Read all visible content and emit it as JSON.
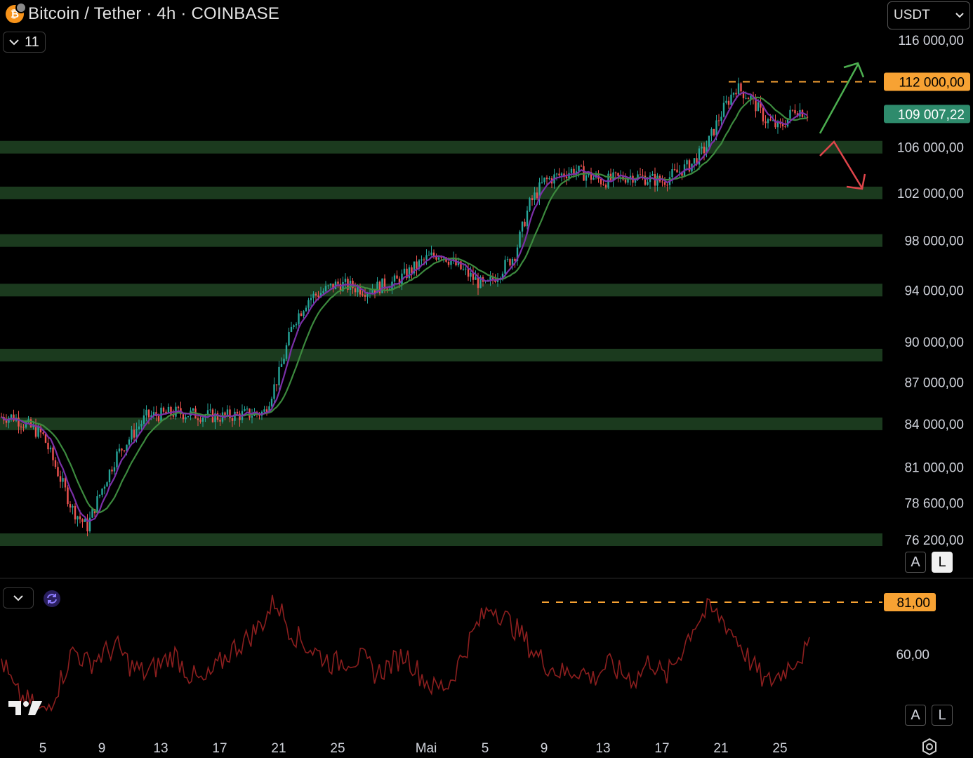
{
  "header": {
    "title": "Bitcoin / Tether · 4h · COINBASE",
    "indicator_count": "11",
    "currency": "USDT"
  },
  "colors": {
    "background": "#000000",
    "up": "#26a69a",
    "down": "#ef5350",
    "zone": "#1b3a1e",
    "ma_fast": "#7b2fa8",
    "ma_slow": "#3c8a3e",
    "rsi": "#8b1e1e",
    "accent_orange": "#f7a233",
    "price_tag": "#2e8b6c"
  },
  "icons": {
    "coin": "bitcoin-icon",
    "toggle": "chevron-down-icon",
    "sync": "sync-icon",
    "brand": "tradingview-logo",
    "settings": "gear-icon"
  },
  "buttons": {
    "auto": "A",
    "log": "L"
  },
  "chart_data": [
    {
      "type": "candlestick",
      "title": "Bitcoin / Tether · 4h · COINBASE",
      "y_ticks": [
        "116 000,00",
        "106 000,00",
        "102 000,00",
        "98 000,00",
        "94 000,00",
        "90 000,00",
        "87 000,00",
        "84 000,00",
        "81 000,00",
        "78 600,00",
        "76 200,00"
      ],
      "y_tick_values": [
        116000,
        106000,
        102000,
        98000,
        94000,
        90000,
        87000,
        84000,
        81000,
        78600,
        76200
      ],
      "x_ticks": [
        "5",
        "9",
        "13",
        "17",
        "21",
        "25",
        "Mai",
        "5",
        "9",
        "13",
        "17",
        "21",
        "25"
      ],
      "series_close": [
        {
          "x": "Apr 3",
          "y": 84500
        },
        {
          "x": "Apr 5",
          "y": 83200
        },
        {
          "x": "Apr 7",
          "y": 78200
        },
        {
          "x": "Apr 8",
          "y": 77000
        },
        {
          "x": "Apr 9",
          "y": 79500
        },
        {
          "x": "Apr 10",
          "y": 81800
        },
        {
          "x": "Apr 12",
          "y": 84500
        },
        {
          "x": "Apr 14",
          "y": 84800
        },
        {
          "x": "Apr 17",
          "y": 84500
        },
        {
          "x": "Apr 20",
          "y": 84800
        },
        {
          "x": "Apr 21",
          "y": 87500
        },
        {
          "x": "Apr 22",
          "y": 91500
        },
        {
          "x": "Apr 23",
          "y": 93300
        },
        {
          "x": "Apr 25",
          "y": 94500
        },
        {
          "x": "Apr 27",
          "y": 94000
        },
        {
          "x": "Apr 29",
          "y": 94700
        },
        {
          "x": "May 1",
          "y": 96500
        },
        {
          "x": "May 2",
          "y": 97000
        },
        {
          "x": "May 3",
          "y": 96000
        },
        {
          "x": "May 5",
          "y": 94200
        },
        {
          "x": "May 7",
          "y": 96800
        },
        {
          "x": "May 8",
          "y": 101000
        },
        {
          "x": "May 9",
          "y": 103000
        },
        {
          "x": "May 11",
          "y": 104000
        },
        {
          "x": "May 13",
          "y": 103000
        },
        {
          "x": "May 15",
          "y": 103500
        },
        {
          "x": "May 17",
          "y": 103000
        },
        {
          "x": "May 19",
          "y": 104500
        },
        {
          "x": "May 20",
          "y": 106000
        },
        {
          "x": "May 21",
          "y": 109000
        },
        {
          "x": "May 22",
          "y": 111500
        },
        {
          "x": "May 23",
          "y": 110500
        },
        {
          "x": "May 24",
          "y": 108500
        },
        {
          "x": "May 25",
          "y": 107700
        },
        {
          "x": "May 26",
          "y": 109500
        },
        {
          "x": "May 27",
          "y": 109007.22
        }
      ],
      "support_resistance_zones": [
        106000,
        102000,
        98000,
        94000,
        89000,
        84000,
        76200
      ],
      "horizontal_line": {
        "label": "112 000,00",
        "value": 112000
      },
      "last_price": {
        "label": "109 007,22",
        "value": 109007.22
      },
      "scenario_arrows": [
        "up",
        "down"
      ],
      "moving_averages": [
        "fast",
        "slow"
      ]
    },
    {
      "type": "line",
      "y_ticks": [
        "60,00"
      ],
      "y_tick_values": [
        60
      ],
      "horizontal_line": {
        "label": "81,00",
        "value": 81
      },
      "series": [
        {
          "values": [
            58,
            44,
            40,
            36,
            48,
            62,
            56,
            60,
            63,
            55,
            52,
            56,
            60,
            52,
            48,
            55,
            62,
            66,
            72,
            82,
            70,
            64,
            60,
            56,
            58,
            58,
            52,
            56,
            60,
            52,
            46,
            48,
            60,
            72,
            80,
            74,
            68,
            60,
            55,
            52,
            54,
            50,
            56,
            52,
            50,
            58,
            50,
            60,
            72,
            78,
            74,
            66,
            56,
            48,
            52,
            58,
            62
          ]
        }
      ]
    }
  ]
}
